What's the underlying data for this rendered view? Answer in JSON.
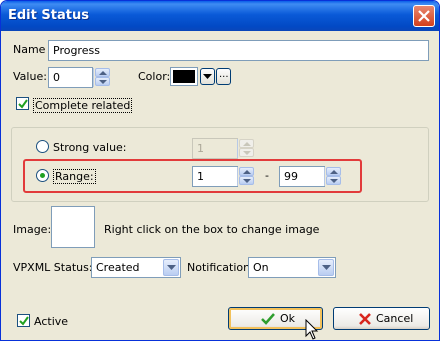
{
  "window": {
    "title": "Edit Status"
  },
  "fields": {
    "name_label": "Name",
    "name_value": "Progress",
    "value_label": "Value:",
    "value_value": "0",
    "color_label": "Color:",
    "color_value": "#000000",
    "color_more_label": "..."
  },
  "complete_related": {
    "label": "Complete related",
    "checked": true
  },
  "mode": {
    "strong_label": "Strong value:",
    "strong_value": "1",
    "range_label": "Range:",
    "range_from": "1",
    "range_separator": "-",
    "range_to": "99",
    "selected": "range"
  },
  "image": {
    "label": "Image:",
    "hint": "Right click on the box to  change image"
  },
  "vpxml": {
    "label": "VPXML Status:",
    "value": "Created"
  },
  "notification": {
    "label": "Notification:",
    "value": "On"
  },
  "active": {
    "label": "Active",
    "checked": true
  },
  "buttons": {
    "ok": "Ok",
    "cancel": "Cancel"
  },
  "colors": {
    "title_bar": "#0a5ad8",
    "highlight": "#e23b3b",
    "dialog_bg": "#ece9d8"
  }
}
